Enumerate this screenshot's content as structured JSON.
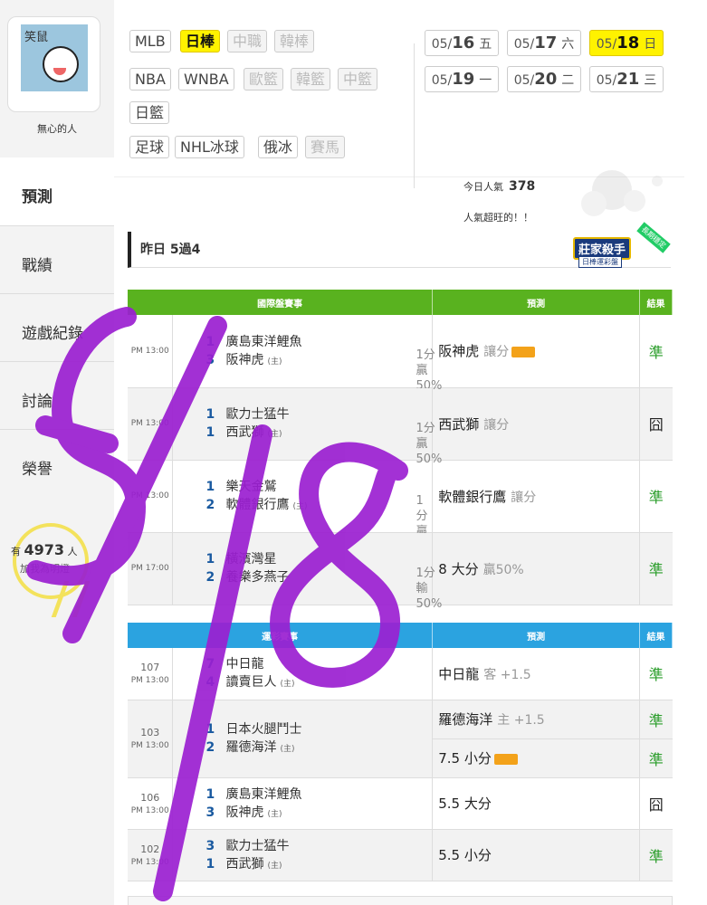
{
  "user": {
    "name": "無心的人",
    "avatar_text": "笑鼠"
  },
  "nav": [
    {
      "label": "預測",
      "active": true
    },
    {
      "label": "戰績"
    },
    {
      "label": "遊戲紀錄"
    },
    {
      "label": "討論"
    },
    {
      "label": "榮譽"
    }
  ],
  "fans": {
    "prefix": "有",
    "count": "4973",
    "suffix": "人",
    "action": "加我為明燈"
  },
  "sports_row1": [
    "MLB",
    "日棒",
    "中職",
    "韓棒"
  ],
  "sports_row2": [
    "NBA",
    "WNBA",
    "歐籃",
    "韓籃",
    "中籃"
  ],
  "sports_row3": [
    "日籃"
  ],
  "sports_row4": [
    "足球",
    "NHL冰球",
    "俄冰",
    "賽馬"
  ],
  "dates": [
    {
      "md": "05/",
      "d": "16",
      "w": "五"
    },
    {
      "md": "05/",
      "d": "17",
      "w": "六"
    },
    {
      "md": "05/",
      "d": "18",
      "w": "日",
      "selected": true
    },
    {
      "md": "05/",
      "d": "19",
      "w": "一"
    },
    {
      "md": "05/",
      "d": "20",
      "w": "二"
    },
    {
      "md": "05/",
      "d": "21",
      "w": "三"
    }
  ],
  "popularity": {
    "label": "今日人氣",
    "value": "378",
    "note": "人氣超旺的！！"
  },
  "yesterday": "昨日 5過4",
  "badge": {
    "title": "莊家殺手",
    "sub": "日棒運彩盤",
    "ribbon": "長期穩定"
  },
  "table1": {
    "headers": [
      "國際盤賽事",
      "預測",
      "結果"
    ],
    "rows": [
      {
        "id": "",
        "time": "PM 13:00",
        "t1num": "1",
        "t1": "廣島東洋鯉魚",
        "t2num": "3",
        "t2": "阪神虎",
        "home": "(主)",
        "odds1": "1分贏",
        "odds2": "50%",
        "pick": "阪神虎",
        "pick_sub": "讓分",
        "tag": true,
        "result": "準"
      },
      {
        "id": "",
        "time": "PM 13:00",
        "t1num": "1",
        "t1": "歐力士猛牛",
        "t2num": "1",
        "t2": "西武獅",
        "home": "(主)",
        "odds1": "1分贏",
        "odds2": "50%",
        "pick": "西武獅",
        "pick_sub": "讓分",
        "tag": false,
        "result": "囧"
      },
      {
        "id": "",
        "time": "PM 13:00",
        "t1num": "1",
        "t1": "樂天金鷲",
        "t2num": "2",
        "t2": "軟體銀行鷹",
        "home": "(主)",
        "odds1": "1分贏",
        "odds2": "",
        "pick": "軟體銀行鷹",
        "pick_sub": "讓分",
        "tag": false,
        "result": "準"
      },
      {
        "id": "",
        "time": "PM 17:00",
        "t1num": "1",
        "t1": "橫濱灣星",
        "t2num": "2",
        "t2": "養樂多燕子",
        "home": "",
        "odds1": "1分輸",
        "odds2": "50%",
        "pick": "8 大分",
        "pick_sub": "贏50%",
        "tag": false,
        "result": "準"
      }
    ]
  },
  "table2": {
    "headers": [
      "運彩賽事",
      "預測",
      "結果"
    ],
    "rows": [
      {
        "id": "107",
        "time": "PM 13:00",
        "t1num": "7",
        "t1": "中日龍",
        "t2num": "4",
        "t2": "讀賣巨人",
        "home": "(主)",
        "picks": [
          {
            "pick": "中日龍",
            "sub": "客 +1.5",
            "tag": false,
            "result": "準"
          }
        ]
      },
      {
        "id": "103",
        "time": "PM 13:00",
        "t1num": "1",
        "t1": "日本火腿鬥士",
        "t2num": "2",
        "t2": "羅德海洋",
        "home": "(主)",
        "picks": [
          {
            "pick": "羅德海洋",
            "sub": "主 +1.5",
            "tag": false,
            "result": "準"
          },
          {
            "pick": "7.5 小分",
            "sub": "",
            "tag": true,
            "result": "準"
          }
        ]
      },
      {
        "id": "106",
        "time": "PM 13:00",
        "t1num": "1",
        "t1": "廣島東洋鯉魚",
        "t2num": "3",
        "t2": "阪神虎",
        "home": "(主)",
        "picks": [
          {
            "pick": "5.5 大分",
            "sub": "",
            "tag": false,
            "result": "囧"
          }
        ]
      },
      {
        "id": "102",
        "time": "PM 13:00",
        "t1num": "3",
        "t1": "歐力士猛牛",
        "t2num": "1",
        "t2": "西武獅",
        "home": "(主)",
        "picks": [
          {
            "pick": "5.5 小分",
            "sub": "",
            "tag": false,
            "result": "準"
          }
        ]
      }
    ]
  },
  "colors": {
    "green_header": "#59b21f",
    "blue_header": "#2ba3e0",
    "selected": "#fff200",
    "scribble": "#9b1fd1",
    "ok": "#2a9d2a"
  }
}
